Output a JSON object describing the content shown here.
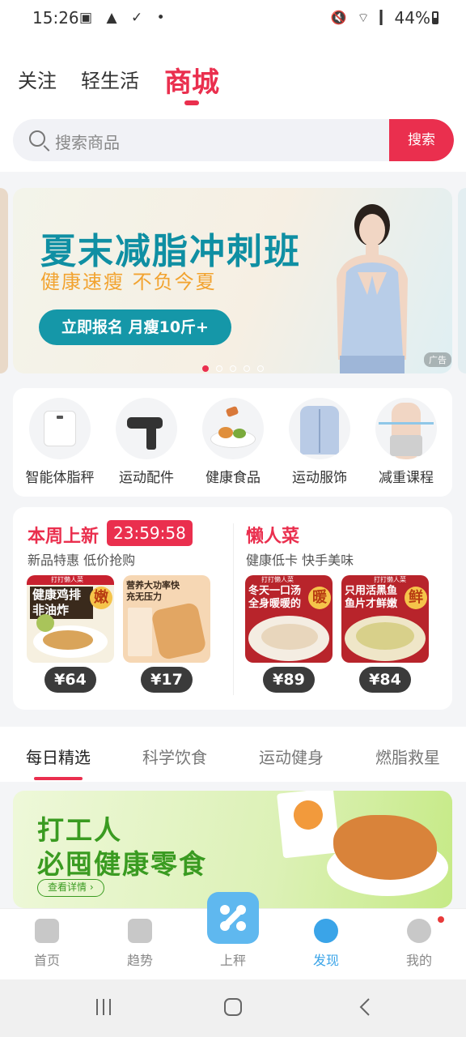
{
  "status_bar": {
    "time": "15:26",
    "left_icons": "▣ ▲ ✓ •",
    "right_icons": "🔇 ⌔ ▎",
    "battery": "44%"
  },
  "top_tabs": [
    "关注",
    "轻生活",
    "商城"
  ],
  "search": {
    "placeholder": "搜索商品",
    "button": "搜索"
  },
  "banner": {
    "title": "夏末减脂冲刺班",
    "subtitle": "健康速瘦  不负今夏",
    "cta": "立即报名 月瘦10斤+",
    "ad_tag": "广告"
  },
  "categories": [
    {
      "label": "智能体脂秤",
      "icon": "scale-icon"
    },
    {
      "label": "运动配件",
      "icon": "massage-gun-icon"
    },
    {
      "label": "健康食品",
      "icon": "food-icon"
    },
    {
      "label": "运动服饰",
      "icon": "jacket-icon"
    },
    {
      "label": "减重课程",
      "icon": "waist-icon"
    }
  ],
  "promo": {
    "left": {
      "title": "本周上新",
      "timer": "23:59:58",
      "subtitle": "新品特惠 低价抢购",
      "products": [
        {
          "tag": "打打懒人菜",
          "text": "健康鸡排非油炸",
          "badge": "嫩",
          "price": "¥64"
        },
        {
          "tag": "",
          "text": "营养大功率快充无压力",
          "badge": "",
          "price": "¥17"
        }
      ]
    },
    "right": {
      "title": "懒人菜",
      "subtitle": "健康低卡 快手美味",
      "products": [
        {
          "tag": "打打懒人菜",
          "text": "冬天一口汤全身暖暖的",
          "badge": "暖",
          "price": "¥89"
        },
        {
          "tag": "打打懒人菜",
          "text": "只用活黑鱼鱼片才鲜嫩",
          "badge": "鲜",
          "price": "¥84"
        }
      ]
    }
  },
  "content_tabs": [
    "每日精选",
    "科学饮食",
    "运动健身",
    "燃脂救星"
  ],
  "banner2": {
    "line1": "打工人",
    "line2": "必囤健康零食",
    "cta": "查看详情 ›"
  },
  "bottom_nav": [
    "首页",
    "趋势",
    "上秤",
    "发现",
    "我的"
  ],
  "colors": {
    "accent": "#ea2f4e",
    "nav_active": "#3aa4e8",
    "banner_teal": "#0f8fa3"
  }
}
